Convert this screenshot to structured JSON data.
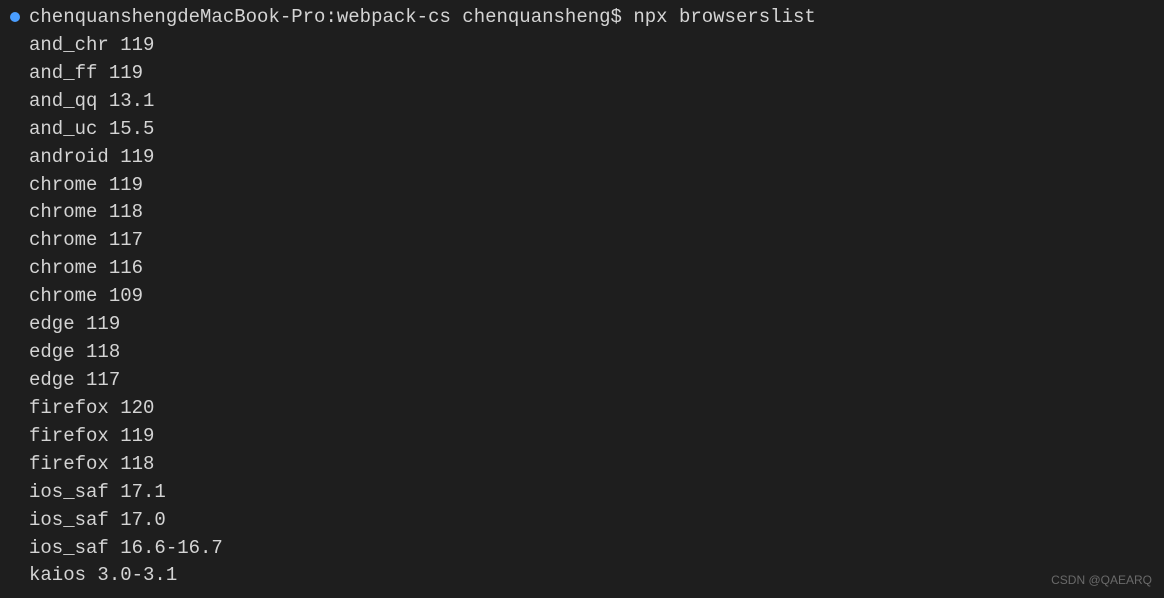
{
  "prompt": {
    "host": "chenquanshengdeMacBook-Pro",
    "directory": "webpack-cs",
    "user": "chenquansheng",
    "symbol": "$",
    "command": "npx browserslist"
  },
  "output": [
    "and_chr 119",
    "and_ff 119",
    "and_qq 13.1",
    "and_uc 15.5",
    "android 119",
    "chrome 119",
    "chrome 118",
    "chrome 117",
    "chrome 116",
    "chrome 109",
    "edge 119",
    "edge 118",
    "edge 117",
    "firefox 120",
    "firefox 119",
    "firefox 118",
    "ios_saf 17.1",
    "ios_saf 17.0",
    "ios_saf 16.6-16.7",
    "kaios 3.0-3.1"
  ],
  "watermark": "CSDN @QAEARQ"
}
